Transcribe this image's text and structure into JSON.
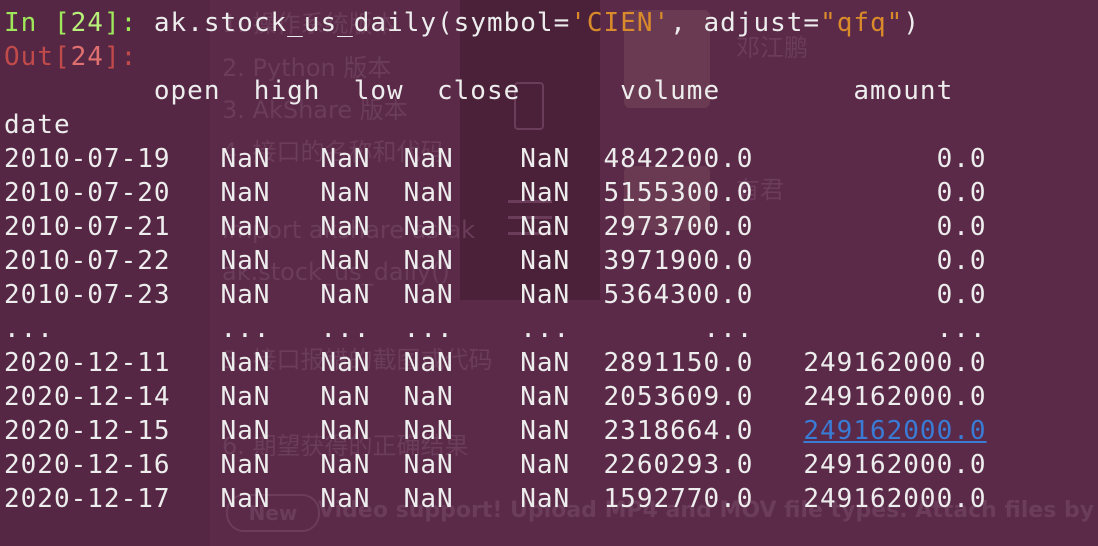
{
  "ghost": {
    "lines": [
      {
        "id": "g1",
        "text": "1. 操作系统版本"
      },
      {
        "id": "g2",
        "text": "2. Python 版本"
      },
      {
        "id": "g3",
        "text": "3. AkShare 版本"
      },
      {
        "id": "g4",
        "text": "4. 接口的名称和代码"
      },
      {
        "id": "g5",
        "text": "import akshare as ak"
      },
      {
        "id": "g6",
        "text": "ak.stock_us_daily()"
      },
      {
        "id": "g7",
        "text": "5. 接口报错的截图或代码"
      },
      {
        "id": "g8",
        "text": "6. 期望获得的正确结果"
      },
      {
        "id": "g9",
        "text": "邓江鹏"
      },
      {
        "id": "g10",
        "text": "有君"
      }
    ],
    "new_badge": "New",
    "banner": "Video support! Upload MP4 and MOV file types. Attach files by"
  },
  "prompt_in": {
    "label": "In [",
    "number": "24",
    "suffix": "]: ",
    "code_prefix": "ak.stock_us_daily(symbol=",
    "symbol_value": "'CIEN'",
    "code_mid": ", adjust=",
    "adjust_value": "\"qfq\"",
    "code_end": ")"
  },
  "prompt_out": {
    "label": "Out[",
    "number": "24",
    "suffix": "]:"
  },
  "table": {
    "header": "         open  high  low  close      volume        amount",
    "index_name": "date",
    "rows": [
      "2010-07-19   NaN   NaN  NaN    NaN  4842200.0           0.0",
      "2010-07-20   NaN   NaN  NaN    NaN  5155300.0           0.0",
      "2010-07-21   NaN   NaN  NaN    NaN  2973700.0           0.0",
      "2010-07-22   NaN   NaN  NaN    NaN  3971900.0           0.0",
      "2010-07-23   NaN   NaN  NaN    NaN  5364300.0           0.0",
      "...          ...   ...  ...    ...        ...           ...",
      "2020-12-11   NaN   NaN  NaN    NaN  2891150.0   249162000.0",
      "2020-12-14   NaN   NaN  NaN    NaN  2053609.0   249162000.0"
    ],
    "row_highlight_prefix": "2020-12-15   NaN   NaN  NaN    NaN  2318664.0   ",
    "row_highlight_link": "249162000.0",
    "rows_tail": [
      "2020-12-16   NaN   NaN  NaN    NaN  2260293.0   249162000.0",
      "2020-12-17   NaN   NaN  NaN    NaN  1592770.0   249162000.0"
    ]
  }
}
